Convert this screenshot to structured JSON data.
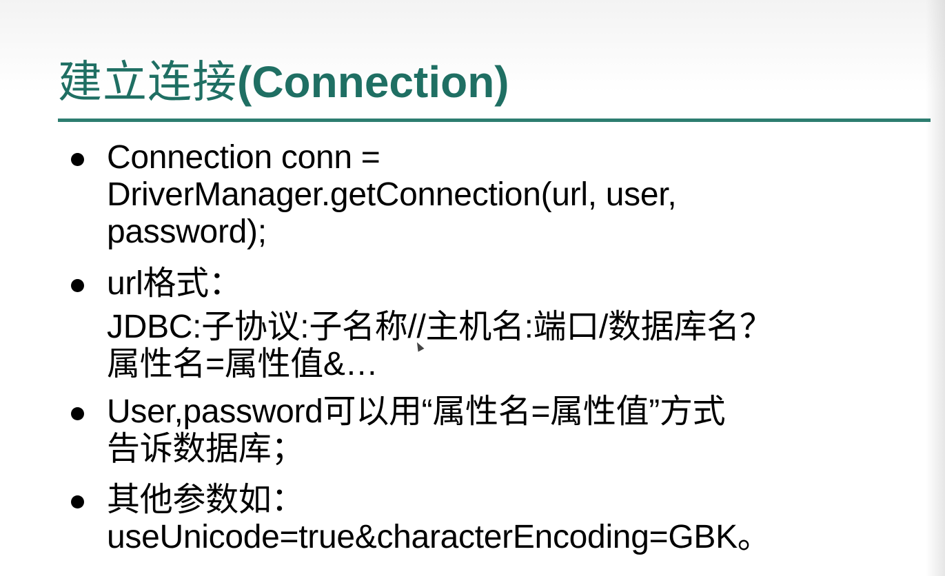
{
  "slide": {
    "title_zh": "建立连接",
    "title_en": "(Connection)",
    "accent_color": "#1f6f63",
    "rule_color": "#2d7d70"
  },
  "bullets": [
    {
      "lines": [
        "Connection conn =",
        "DriverManager.getConnection(url, user,",
        "password);"
      ]
    },
    {
      "lines": [
        "url格式：",
        "JDBC:子协议:子名称//主机名:端口/数据库名？",
        "属性名=属性值&…"
      ]
    },
    {
      "lines": [
        "User,password可以用“属性名=属性值”方式",
        "告诉数据库；"
      ]
    },
    {
      "lines": [
        "其他参数如：",
        "useUnicode=true&characterEncoding=GBK。"
      ]
    }
  ]
}
